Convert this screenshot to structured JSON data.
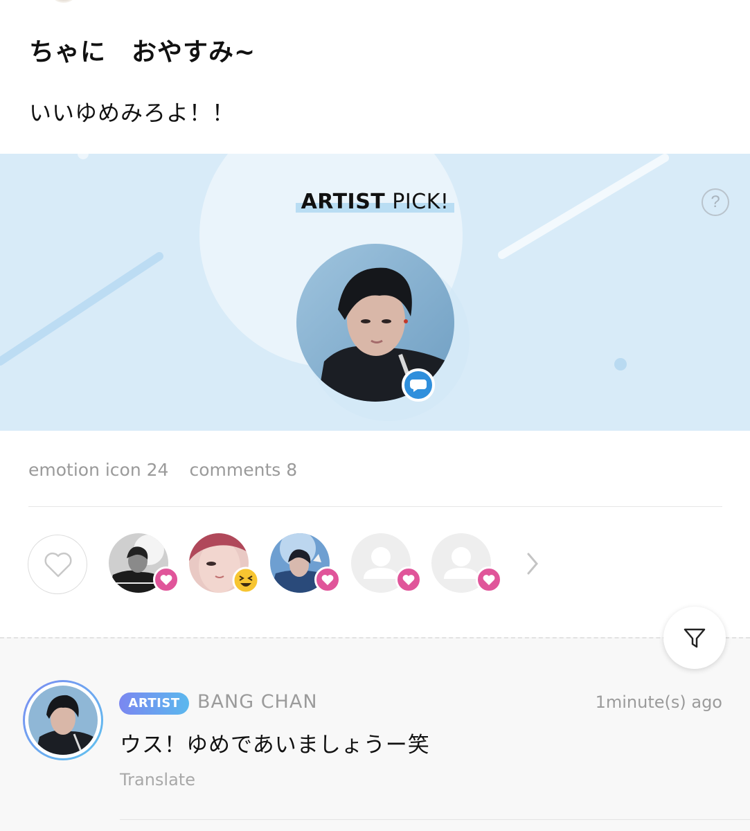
{
  "post": {
    "title": "ちゃに　おやすみ~",
    "body": "いいゆめみろよ！！"
  },
  "artist_pick": {
    "heading_bold": "ARTIST",
    "heading_rest": " PICK!",
    "help_glyph": "?"
  },
  "stats": {
    "emotion_label": "emotion icon 24",
    "comments_label": "comments 8"
  },
  "reactions": {
    "reactors": [
      {
        "reaction": "heart",
        "avatar": "photo-grayscale"
      },
      {
        "reaction": "laugh-emoji",
        "avatar": "photo-pink"
      },
      {
        "reaction": "heart",
        "avatar": "photo-blue"
      },
      {
        "reaction": "heart",
        "avatar": "default-user"
      },
      {
        "reaction": "heart",
        "avatar": "default-user"
      }
    ]
  },
  "comment": {
    "badge": "ARTIST",
    "author": "BANG CHAN",
    "time": "1minute(s) ago",
    "text": "ウス！ゆめであいましょうー笑",
    "translate": "Translate"
  },
  "colors": {
    "pick_bg": "#d8ebf8",
    "heart": "#e0559a",
    "accent_blue": "#2f8fdc",
    "artist_gradient_start": "#7b87f0",
    "artist_gradient_end": "#5bb8ee"
  }
}
